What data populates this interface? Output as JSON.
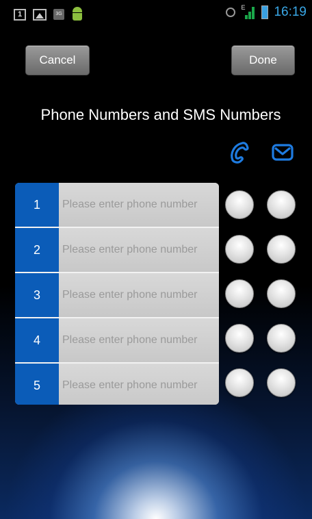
{
  "status_bar": {
    "notification_count": "1",
    "network_type": "3G",
    "signal_label": "E",
    "time": "16:19"
  },
  "toolbar": {
    "cancel_label": "Cancel",
    "done_label": "Done"
  },
  "page": {
    "title": "Phone Numbers and SMS Numbers"
  },
  "columns": {
    "call_icon": "phone-icon",
    "sms_icon": "envelope-icon"
  },
  "rows": [
    {
      "index": "1",
      "value": "",
      "placeholder": "Please enter phone number"
    },
    {
      "index": "2",
      "value": "",
      "placeholder": "Please enter phone number"
    },
    {
      "index": "3",
      "value": "",
      "placeholder": "Please enter phone number"
    },
    {
      "index": "4",
      "value": "",
      "placeholder": "Please enter phone number"
    },
    {
      "index": "5",
      "value": "",
      "placeholder": "Please enter phone number"
    }
  ],
  "colors": {
    "accent": "#0b5cb8",
    "icon_blue": "#1e7be0",
    "clock_blue": "#39a7e6"
  }
}
